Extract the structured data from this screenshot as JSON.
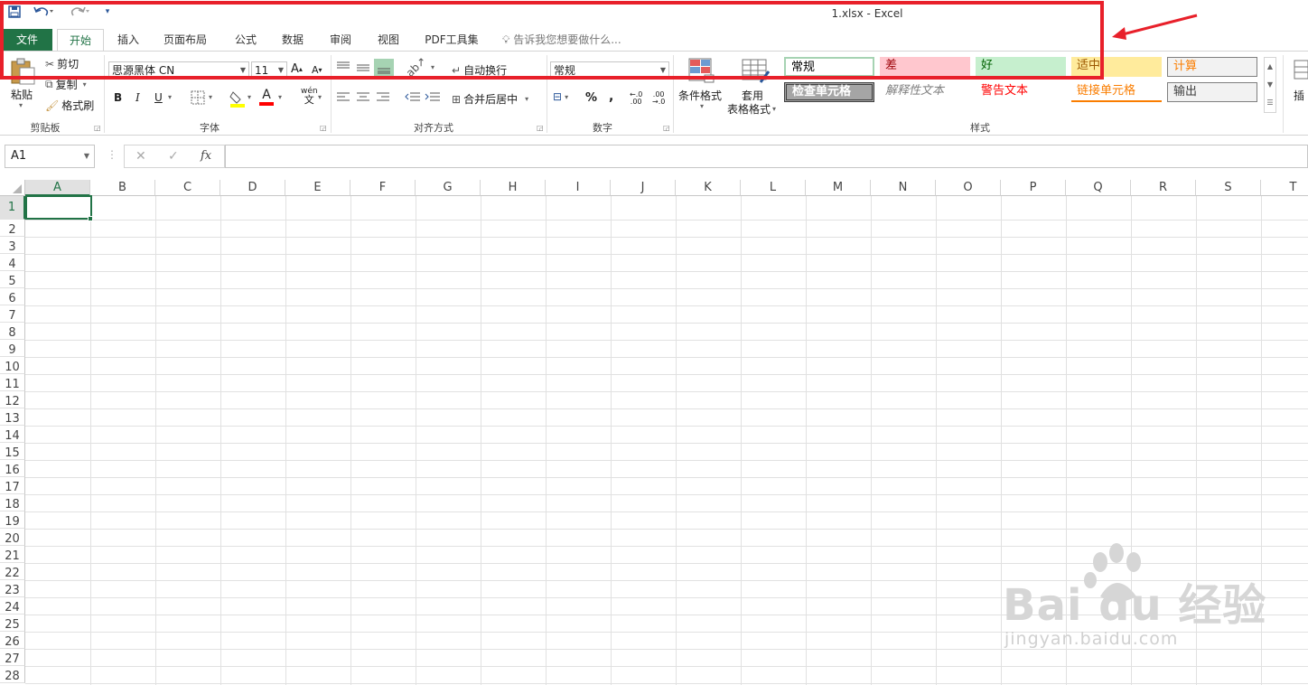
{
  "window": {
    "title": "1.xlsx - Excel"
  },
  "tabs": {
    "file": "文件",
    "items": [
      "开始",
      "插入",
      "页面布局",
      "公式",
      "数据",
      "审阅",
      "视图",
      "PDF工具集"
    ],
    "tell_me": "告诉我您想要做什么..."
  },
  "clipboard": {
    "paste": "粘贴",
    "cut": "剪切",
    "copy": "复制",
    "format_painter": "格式刷",
    "label": "剪贴板"
  },
  "font": {
    "name": "思源黑体 CN",
    "size": "11",
    "label": "字体",
    "bold": "B",
    "italic": "I",
    "underline": "U"
  },
  "alignment": {
    "wrap": "自动换行",
    "merge": "合并后居中",
    "label": "对齐方式"
  },
  "number": {
    "format": "常规",
    "percent": "%",
    "comma": ",",
    "label": "数字"
  },
  "styles": {
    "conditional": "条件格式",
    "table_line1": "套用",
    "table_line2": "表格格式",
    "label": "样式",
    "cells": [
      {
        "text": "常规",
        "bg": "#ffffff",
        "color": "#000000"
      },
      {
        "text": "差",
        "bg": "#ffc7ce",
        "color": "#9c0006"
      },
      {
        "text": "好",
        "bg": "#c6efce",
        "color": "#006100"
      },
      {
        "text": "适中",
        "bg": "#ffeb9c",
        "color": "#9c5700"
      },
      {
        "text": "计算",
        "bg": "#f2f2f2",
        "color": "#fa7d00"
      },
      {
        "text": "检查单元格",
        "bg": "#a5a5a5",
        "color": "#ffffff"
      },
      {
        "text": "解释性文本",
        "bg": "#ffffff",
        "color": "#7f7f7f"
      },
      {
        "text": "警告文本",
        "bg": "#ffffff",
        "color": "#ff0000"
      },
      {
        "text": "链接单元格",
        "bg": "#ffffff",
        "color": "#fa7d00"
      },
      {
        "text": "输出",
        "bg": "#f2f2f2",
        "color": "#3f3f3f"
      }
    ]
  },
  "insert_partial": "插",
  "formula_bar": {
    "name_box": "A1",
    "fx": "fx"
  },
  "grid": {
    "columns": [
      "A",
      "B",
      "C",
      "D",
      "E",
      "F",
      "G",
      "H",
      "I",
      "J",
      "K",
      "L",
      "M",
      "N",
      "O",
      "P",
      "Q",
      "R",
      "S",
      "T"
    ],
    "rows": [
      "1",
      "2",
      "3",
      "4",
      "5",
      "6",
      "7",
      "8",
      "9",
      "10",
      "11",
      "12",
      "13",
      "14",
      "15",
      "16",
      "17",
      "18",
      "19",
      "20",
      "21",
      "22",
      "23",
      "24",
      "25",
      "26",
      "27",
      "28"
    ]
  },
  "watermark": {
    "main": "Bai du 经验",
    "sub": "jingyan.baidu.com"
  },
  "colors": {
    "accent": "#217346",
    "annotation": "#e8202a"
  }
}
